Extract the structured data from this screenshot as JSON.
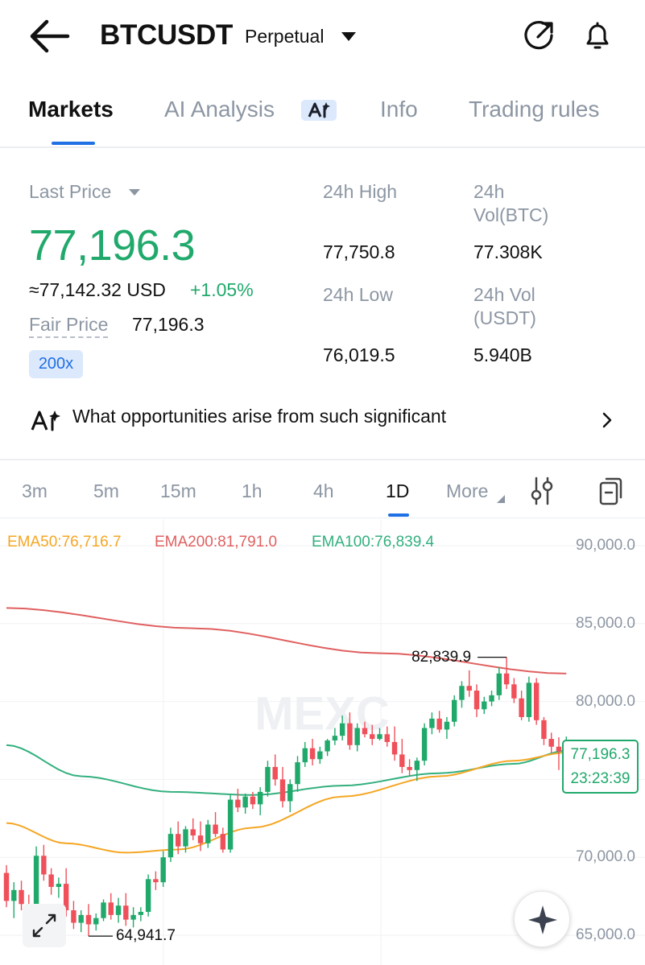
{
  "header": {
    "symbol": "BTCUSDT",
    "contract_type": "Perpetual",
    "icons": [
      "back-arrow-icon",
      "share-arrow-icon",
      "bell-icon"
    ]
  },
  "tabs": [
    {
      "label": "Markets",
      "active": true
    },
    {
      "label": "AI Analysis",
      "active": false
    },
    {
      "label": "Info",
      "active": false
    },
    {
      "label": "Trading rules",
      "active": false
    }
  ],
  "stats": {
    "last_price_label": "Last Price",
    "last_price": "77,196.3",
    "usd_equiv": "≈77,142.32 USD",
    "change_pct": "+1.05%",
    "fair_price_label": "Fair Price",
    "fair_price": "77,196.3",
    "leverage": "200x",
    "high_label": "24h High",
    "high": "77,750.8",
    "low_label": "24h Low",
    "low": "76,019.5",
    "vol_btc_label_1": "24h",
    "vol_btc_label_2": "Vol(BTC)",
    "vol_btc": "77.308K",
    "vol_usdt_label_1": "24h Vol",
    "vol_usdt_label_2": "(USDT)",
    "vol_usdt": "5.940B"
  },
  "ai_prompt": {
    "text": "What opportunities arise from such significant"
  },
  "intervals": [
    {
      "label": "3m",
      "active": false
    },
    {
      "label": "5m",
      "active": false
    },
    {
      "label": "15m",
      "active": false
    },
    {
      "label": "1h",
      "active": false
    },
    {
      "label": "4h",
      "active": false
    },
    {
      "label": "1D",
      "active": true
    },
    {
      "label": "More",
      "active": false
    }
  ],
  "chart_legend": {
    "ema50": "EMA50:76,716.7",
    "ema200": "EMA200:81,791.0",
    "ema100": "EMA100:76,839.4"
  },
  "colors": {
    "up": "#20a96b",
    "down": "#f0505a",
    "ema50": "#f5a623",
    "ema200": "#e06060",
    "ema100": "#33b07f",
    "accent": "#1f6fe5"
  },
  "chart_data": {
    "type": "candlestick",
    "title": "",
    "interval": "1D",
    "ylim": [
      64000,
      91000
    ],
    "y_ticks": [
      "90,000.0",
      "85,000.0",
      "80,000.0",
      "70,000.0",
      "65,000.0"
    ],
    "y_tick_values": [
      90000,
      85000,
      80000,
      70000,
      65000
    ],
    "high_marker": "82,839.9",
    "high_marker_value": 82839.9,
    "low_marker": "64,941.7",
    "low_marker_value": 64941.7,
    "last_price": 77196.3,
    "last_price_label": "77,196.3",
    "countdown": "23:23:39",
    "candles_ohlc": [
      [
        69000,
        69500,
        66800,
        67200
      ],
      [
        67200,
        68400,
        66100,
        67900
      ],
      [
        67900,
        68500,
        66600,
        67000
      ],
      [
        67000,
        67600,
        65800,
        66400
      ],
      [
        66400,
        70700,
        66200,
        70100
      ],
      [
        70100,
        70800,
        68500,
        68900
      ],
      [
        68900,
        69300,
        67600,
        68100
      ],
      [
        68100,
        68700,
        67400,
        68300
      ],
      [
        68300,
        69300,
        66200,
        66600
      ],
      [
        66600,
        67200,
        65400,
        65800
      ],
      [
        65800,
        66600,
        65200,
        66300
      ],
      [
        66300,
        67000,
        64941.7,
        65700
      ],
      [
        65700,
        66400,
        65300,
        66100
      ],
      [
        66100,
        67300,
        65900,
        67100
      ],
      [
        67100,
        67700,
        66000,
        66300
      ],
      [
        66300,
        67400,
        65800,
        66900
      ],
      [
        66900,
        67700,
        65600,
        66000
      ],
      [
        66000,
        66800,
        65500,
        66300
      ],
      [
        66300,
        66800,
        65900,
        66500
      ],
      [
        66500,
        68900,
        66200,
        68600
      ],
      [
        68600,
        69100,
        67900,
        68400
      ],
      [
        68400,
        70400,
        68100,
        70000
      ],
      [
        70000,
        71900,
        69700,
        71500
      ],
      [
        71500,
        72300,
        70200,
        70700
      ],
      [
        70700,
        72000,
        70300,
        71800
      ],
      [
        71800,
        72500,
        71100,
        71400
      ],
      [
        71400,
        72300,
        70400,
        70900
      ],
      [
        70900,
        72400,
        70600,
        72100
      ],
      [
        72100,
        72900,
        71300,
        71500
      ],
      [
        71500,
        71900,
        70300,
        70500
      ],
      [
        70500,
        74000,
        70300,
        73700
      ],
      [
        73700,
        74400,
        72900,
        73200
      ],
      [
        73200,
        74100,
        72800,
        73900
      ],
      [
        73900,
        74200,
        73100,
        73400
      ],
      [
        73400,
        74500,
        72700,
        74200
      ],
      [
        74200,
        76200,
        73900,
        75800
      ],
      [
        75800,
        76600,
        74600,
        75000
      ],
      [
        75000,
        75800,
        73200,
        73600
      ],
      [
        73600,
        75000,
        72900,
        74700
      ],
      [
        74700,
        76500,
        74200,
        76100
      ],
      [
        76100,
        77400,
        75800,
        77000
      ],
      [
        77000,
        77600,
        75900,
        76300
      ],
      [
        76300,
        77100,
        76000,
        76800
      ],
      [
        76800,
        77600,
        76500,
        77500
      ],
      [
        77500,
        78300,
        77200,
        77800
      ],
      [
        77800,
        79100,
        77500,
        78600
      ],
      [
        78600,
        79300,
        76900,
        77200
      ],
      [
        77200,
        78600,
        76800,
        78300
      ],
      [
        78300,
        78700,
        77700,
        77900
      ],
      [
        77900,
        78500,
        77200,
        77600
      ],
      [
        77600,
        78300,
        77500,
        77900
      ],
      [
        77900,
        78400,
        77100,
        77400
      ],
      [
        77400,
        78400,
        76200,
        76600
      ],
      [
        76600,
        77600,
        75400,
        75800
      ],
      [
        75800,
        76300,
        75200,
        75600
      ],
      [
        75600,
        76400,
        74900,
        76200
      ],
      [
        76200,
        78600,
        75900,
        78300
      ],
      [
        78300,
        79300,
        77900,
        78900
      ],
      [
        78900,
        79400,
        78000,
        78200
      ],
      [
        78200,
        79000,
        77600,
        78700
      ],
      [
        78700,
        80400,
        78400,
        80100
      ],
      [
        80100,
        81300,
        79600,
        81000
      ],
      [
        81000,
        82000,
        80300,
        80700
      ],
      [
        80700,
        81100,
        79000,
        79500
      ],
      [
        79500,
        80300,
        79200,
        80000
      ],
      [
        80000,
        80700,
        79700,
        80400
      ],
      [
        80400,
        82200,
        80100,
        81800
      ],
      [
        81800,
        82839.9,
        80800,
        81100
      ],
      [
        81100,
        81500,
        79900,
        80200
      ],
      [
        80200,
        80700,
        78800,
        79000
      ],
      [
        79000,
        81600,
        78700,
        81200
      ],
      [
        81200,
        81500,
        78500,
        78800
      ],
      [
        78800,
        79000,
        77200,
        77600
      ],
      [
        77600,
        78000,
        76700,
        77100
      ],
      [
        77100,
        77700,
        75600,
        76800
      ],
      [
        76800,
        77750.8,
        76019.5,
        77196.3
      ]
    ],
    "ema200_points": [
      [
        0,
        86000
      ],
      [
        25,
        84700
      ],
      [
        50,
        83100
      ],
      [
        75,
        81791.0
      ]
    ],
    "ema100_points": [
      [
        0,
        77200
      ],
      [
        10,
        75200
      ],
      [
        22,
        74200
      ],
      [
        33,
        74000
      ],
      [
        45,
        74600
      ],
      [
        58,
        75400
      ],
      [
        68,
        76000
      ],
      [
        75,
        76839.4
      ]
    ],
    "ema50_points": [
      [
        0,
        72200
      ],
      [
        8,
        70900
      ],
      [
        16,
        70300
      ],
      [
        23,
        70500
      ],
      [
        33,
        71900
      ],
      [
        45,
        73900
      ],
      [
        58,
        75200
      ],
      [
        68,
        76200
      ],
      [
        75,
        76716.7
      ]
    ],
    "watermark": "MEXC"
  }
}
